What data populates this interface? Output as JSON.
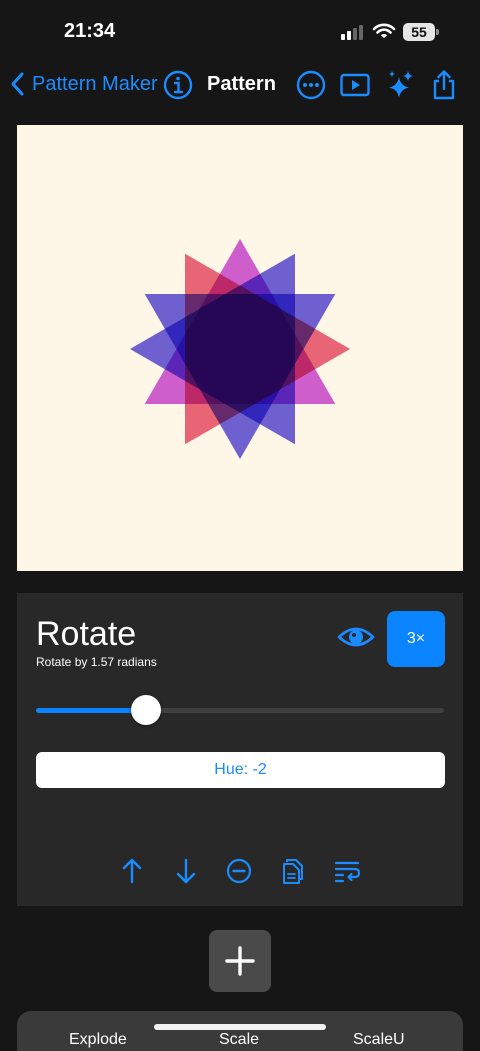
{
  "status_bar": {
    "time": "21:34",
    "battery": "55"
  },
  "nav": {
    "back_label": "Pattern Maker",
    "title": "Pattern"
  },
  "panel": {
    "title": "Rotate",
    "subtitle": "Rotate by 1.57 radians",
    "multiplier_label": "3×",
    "slider_value": 0.27,
    "hue_button_label": "Hue: -2"
  },
  "bottom_sheet": {
    "items": [
      "Explode",
      "Scale",
      "ScaleU"
    ]
  },
  "colors": {
    "accent": "#0a84ff",
    "canvas_bg": "#fef6e6",
    "star_red": "#e23f5d",
    "star_magenta": "#c234d8",
    "star_blue": "#4637e0"
  },
  "icons": [
    "chevron-left-icon",
    "info-icon",
    "ellipsis-icon",
    "play-icon",
    "sparkles-icon",
    "share-icon",
    "eye-icon",
    "arrow-up-icon",
    "arrow-down-icon",
    "minus-circle-icon",
    "documents-icon",
    "wrap-text-icon",
    "plus-icon"
  ]
}
